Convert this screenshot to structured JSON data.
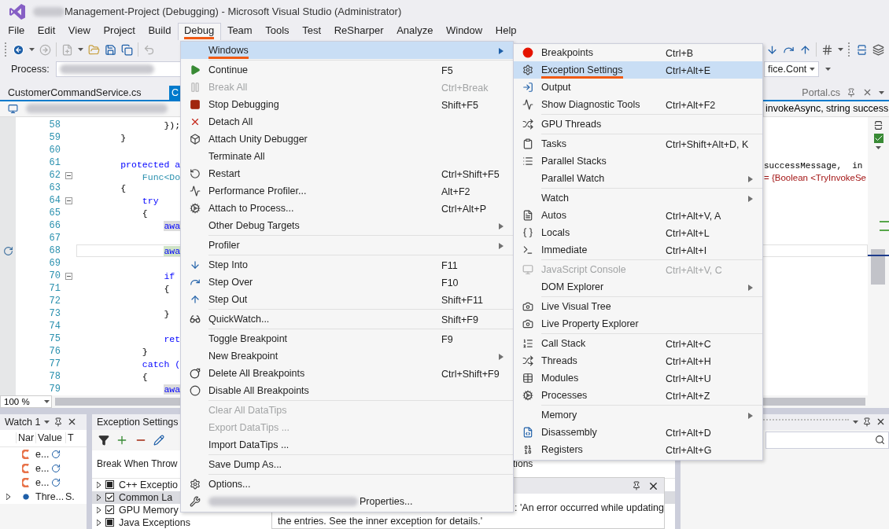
{
  "window": {
    "title": "Management-Project (Debugging) - Microsoft Visual Studio  (Administrator)"
  },
  "menu_bar": [
    {
      "label": "File",
      "selected": false,
      "marked": false
    },
    {
      "label": "Edit",
      "selected": false,
      "marked": false
    },
    {
      "label": "View",
      "selected": false,
      "marked": false
    },
    {
      "label": "Project",
      "selected": false,
      "marked": false
    },
    {
      "label": "Build",
      "selected": false,
      "marked": false
    },
    {
      "label": "Debug",
      "selected": true,
      "marked": true
    },
    {
      "label": "Team",
      "selected": false,
      "marked": false
    },
    {
      "label": "Tools",
      "selected": false,
      "marked": false
    },
    {
      "label": "Test",
      "selected": false,
      "marked": false
    },
    {
      "label": "ReSharper",
      "selected": false,
      "marked": false
    },
    {
      "label": "Analyze",
      "selected": false,
      "marked": false
    },
    {
      "label": "Window",
      "selected": false,
      "marked": false
    },
    {
      "label": "Help",
      "selected": false,
      "marked": false
    }
  ],
  "process_bar": {
    "label": "Process:",
    "target": "fice.Cont"
  },
  "editor_tabs": [
    {
      "label": "CustomerCommandService.cs",
      "selected": false
    },
    {
      "label": "C",
      "selected": true
    }
  ],
  "right_tab": {
    "label": "Portal.cs",
    "selected": false
  },
  "navigation": {
    "member": "invokeAsync, string success"
  },
  "editor": {
    "lines": [
      {
        "number": "58",
        "code": "                });",
        "kind": "plain",
        "foldable": false,
        "current": false,
        "shaded": false
      },
      {
        "number": "59",
        "code": "        }",
        "kind": "plain",
        "foldable": false,
        "current": false,
        "shaded": false
      },
      {
        "number": "60",
        "foldable": false,
        "current": false
      },
      {
        "number": "61",
        "code": "        protected a",
        "kind": "keyword",
        "foldable": false,
        "current": false,
        "shaded": false,
        "right": {
          "text": "successMessage,  in",
          "kind": "code"
        }
      },
      {
        "number": "62",
        "code": "            Func<Do",
        "kind": "type",
        "foldable": true,
        "current": false,
        "shaded": false,
        "right": {
          "text": "= {Boolean <TryInvokeSe",
          "kind": "datatip"
        }
      },
      {
        "number": "63",
        "code": "        {",
        "kind": "plain",
        "foldable": false,
        "current": false,
        "shaded": false
      },
      {
        "number": "64",
        "code": "            try",
        "kind": "keyword",
        "foldable": true,
        "current": false,
        "shaded": false
      },
      {
        "number": "65",
        "code": "            {",
        "kind": "plain",
        "foldable": false,
        "current": false,
        "shaded": false
      },
      {
        "number": "66",
        "code": "                awa",
        "kind": "keyword",
        "foldable": false,
        "current": false,
        "shaded": true
      },
      {
        "number": "67",
        "foldable": false,
        "current": false
      },
      {
        "number": "68",
        "code": "                awa",
        "kind": "keyword",
        "foldable": false,
        "current": true,
        "shaded": true
      },
      {
        "number": "69",
        "foldable": false,
        "current": false
      },
      {
        "number": "70",
        "code": "                if",
        "kind": "keyword",
        "foldable": true,
        "current": false,
        "shaded": false
      },
      {
        "number": "71",
        "code": "                {",
        "kind": "plain",
        "foldable": false,
        "current": false,
        "shaded": false
      },
      {
        "number": "72",
        "foldable": false,
        "current": false
      },
      {
        "number": "73",
        "code": "                }",
        "kind": "plain",
        "foldable": false,
        "current": false,
        "shaded": false
      },
      {
        "number": "74",
        "foldable": false,
        "current": false
      },
      {
        "number": "75",
        "code": "                ret",
        "kind": "keyword",
        "foldable": false,
        "current": false,
        "shaded": false
      },
      {
        "number": "76",
        "code": "            }",
        "kind": "plain",
        "foldable": false,
        "current": false,
        "shaded": false
      },
      {
        "number": "77",
        "code": "            catch (",
        "kind": "keyword",
        "foldable": false,
        "current": false,
        "shaded": false
      },
      {
        "number": "78",
        "code": "            {",
        "kind": "plain",
        "foldable": false,
        "current": false,
        "shaded": false
      },
      {
        "number": "79",
        "code": "                awa",
        "kind": "keyword",
        "foldable": false,
        "current": false,
        "shaded": true
      }
    ]
  },
  "zoom": "100 %",
  "watch": {
    "title": "Watch 1",
    "columns": [
      "Nar",
      "Value",
      "T"
    ],
    "rows": [
      {
        "kind": "exception",
        "value": "e..."
      },
      {
        "kind": "exception",
        "value": "e..."
      },
      {
        "kind": "exception",
        "value": "e..."
      },
      {
        "kind": "thread",
        "value": "Thre...",
        "type": "S."
      }
    ]
  },
  "exception_settings": {
    "title": "Exception Settings",
    "columns": [
      "Break When Throw",
      "tions"
    ],
    "rows": [
      {
        "label": "C++ Exceptio",
        "checked": false,
        "selected": false
      },
      {
        "label": "Common La",
        "checked": true,
        "selected": true
      },
      {
        "label": "GPU Memory",
        "checked": true,
        "selected": false
      },
      {
        "label": "Java Exceptions",
        "checked": false,
        "selected": false
      }
    ]
  },
  "exception_popup": {
    "lines": [
      ": 'An error occurred while updating",
      "the entries. See the inner exception for details.'"
    ]
  },
  "debug_menu": [
    {
      "kind": "item",
      "label": "Windows",
      "disabled": false,
      "submenu": true,
      "selected": true,
      "marked": true
    },
    {
      "kind": "separator"
    },
    {
      "kind": "item",
      "label": "Continue",
      "shortcut": "F5",
      "disabled": false,
      "submenu": false,
      "selected": false,
      "marked": false
    },
    {
      "kind": "item",
      "label": "Break All",
      "shortcut": "Ctrl+Break",
      "disabled": true,
      "submenu": false,
      "selected": false,
      "marked": false
    },
    {
      "kind": "item",
      "label": "Stop Debugging",
      "shortcut": "Shift+F5",
      "disabled": false,
      "submenu": false,
      "selected": false,
      "marked": false
    },
    {
      "kind": "item",
      "label": "Detach All",
      "disabled": false,
      "submenu": false,
      "selected": false,
      "marked": false
    },
    {
      "kind": "item",
      "label": "Attach Unity Debugger",
      "disabled": false,
      "submenu": false,
      "selected": false,
      "marked": false
    },
    {
      "kind": "item",
      "label": "Terminate All",
      "disabled": false,
      "submenu": false,
      "selected": false,
      "marked": false
    },
    {
      "kind": "item",
      "label": "Restart",
      "shortcut": "Ctrl+Shift+F5",
      "disabled": false,
      "submenu": false,
      "selected": false,
      "marked": false
    },
    {
      "kind": "item",
      "label": "Performance Profiler...",
      "shortcut": "Alt+F2",
      "disabled": false,
      "submenu": false,
      "selected": false,
      "marked": false
    },
    {
      "kind": "item",
      "label": "Attach to Process...",
      "shortcut": "Ctrl+Alt+P",
      "disabled": false,
      "submenu": false,
      "selected": false,
      "marked": false
    },
    {
      "kind": "item",
      "label": "Other Debug Targets",
      "disabled": false,
      "submenu": true,
      "selected": false,
      "marked": false
    },
    {
      "kind": "separator"
    },
    {
      "kind": "item",
      "label": "Profiler",
      "disabled": false,
      "submenu": true,
      "selected": false,
      "marked": false
    },
    {
      "kind": "separator"
    },
    {
      "kind": "item",
      "label": "Step Into",
      "shortcut": "F11",
      "disabled": false,
      "submenu": false,
      "selected": false,
      "marked": false
    },
    {
      "kind": "item",
      "label": "Step Over",
      "shortcut": "F10",
      "disabled": false,
      "submenu": false,
      "selected": false,
      "marked": false
    },
    {
      "kind": "item",
      "label": "Step Out",
      "shortcut": "Shift+F11",
      "disabled": false,
      "submenu": false,
      "selected": false,
      "marked": false
    },
    {
      "kind": "separator"
    },
    {
      "kind": "item",
      "label": "QuickWatch...",
      "shortcut": "Shift+F9",
      "disabled": false,
      "submenu": false,
      "selected": false,
      "marked": false
    },
    {
      "kind": "separator"
    },
    {
      "kind": "item",
      "label": "Toggle Breakpoint",
      "shortcut": "F9",
      "disabled": false,
      "submenu": false,
      "selected": false,
      "marked": false
    },
    {
      "kind": "item",
      "label": "New Breakpoint",
      "disabled": false,
      "submenu": true,
      "selected": false,
      "marked": false
    },
    {
      "kind": "item",
      "label": "Delete All Breakpoints",
      "shortcut": "Ctrl+Shift+F9",
      "disabled": false,
      "submenu": false,
      "selected": false,
      "marked": false
    },
    {
      "kind": "item",
      "label": "Disable All Breakpoints",
      "disabled": false,
      "submenu": false,
      "selected": false,
      "marked": false
    },
    {
      "kind": "separator"
    },
    {
      "kind": "item",
      "label": "Clear All DataTips",
      "disabled": true,
      "submenu": false,
      "selected": false,
      "marked": false
    },
    {
      "kind": "item",
      "label": "Export DataTips ...",
      "disabled": true,
      "submenu": false,
      "selected": false,
      "marked": false
    },
    {
      "kind": "item",
      "label": "Import DataTips ...",
      "disabled": false,
      "submenu": false,
      "selected": false,
      "marked": false
    },
    {
      "kind": "separator"
    },
    {
      "kind": "item",
      "label": "Save Dump As...",
      "disabled": false,
      "submenu": false,
      "selected": false,
      "marked": false
    },
    {
      "kind": "separator"
    },
    {
      "kind": "item",
      "label": "Options...",
      "disabled": false,
      "submenu": false,
      "selected": false,
      "marked": false
    },
    {
      "kind": "item",
      "label": "Properties...",
      "disabled": false,
      "submenu": false,
      "selected": false,
      "marked": false,
      "blurred_prefix": true
    }
  ],
  "windows_menu": [
    {
      "kind": "item",
      "label": "Breakpoints",
      "shortcut": "Ctrl+B",
      "disabled": false,
      "submenu": false,
      "selected": false,
      "marked": false
    },
    {
      "kind": "item",
      "label": "Exception Settings",
      "shortcut": "Ctrl+Alt+E",
      "disabled": false,
      "submenu": false,
      "selected": true,
      "marked": true
    },
    {
      "kind": "item",
      "label": "Output",
      "disabled": false,
      "submenu": false,
      "selected": false,
      "marked": false
    },
    {
      "kind": "item",
      "label": "Show Diagnostic Tools",
      "shortcut": "Ctrl+Alt+F2",
      "disabled": false,
      "submenu": false,
      "selected": false,
      "marked": false
    },
    {
      "kind": "separator"
    },
    {
      "kind": "item",
      "label": "GPU Threads",
      "disabled": false,
      "submenu": false,
      "selected": false,
      "marked": false
    },
    {
      "kind": "separator"
    },
    {
      "kind": "item",
      "label": "Tasks",
      "shortcut": "Ctrl+Shift+Alt+D, K",
      "disabled": false,
      "submenu": false,
      "selected": false,
      "marked": false
    },
    {
      "kind": "item",
      "label": "Parallel Stacks",
      "disabled": false,
      "submenu": false,
      "selected": false,
      "marked": false
    },
    {
      "kind": "item",
      "label": "Parallel Watch",
      "disabled": false,
      "submenu": true,
      "selected": false,
      "marked": false
    },
    {
      "kind": "separator"
    },
    {
      "kind": "item",
      "label": "Watch",
      "disabled": false,
      "submenu": true,
      "selected": false,
      "marked": false
    },
    {
      "kind": "item",
      "label": "Autos",
      "shortcut": "Ctrl+Alt+V, A",
      "disabled": false,
      "submenu": false,
      "selected": false,
      "marked": false
    },
    {
      "kind": "item",
      "label": "Locals",
      "shortcut": "Ctrl+Alt+L",
      "disabled": false,
      "submenu": false,
      "selected": false,
      "marked": false
    },
    {
      "kind": "item",
      "label": "Immediate",
      "shortcut": "Ctrl+Alt+I",
      "disabled": false,
      "submenu": false,
      "selected": false,
      "marked": false
    },
    {
      "kind": "separator"
    },
    {
      "kind": "item",
      "label": "JavaScript Console",
      "shortcut": "Ctrl+Alt+V, C",
      "disabled": true,
      "submenu": false,
      "selected": false,
      "marked": false
    },
    {
      "kind": "item",
      "label": "DOM Explorer",
      "disabled": false,
      "submenu": true,
      "selected": false,
      "marked": false
    },
    {
      "kind": "separator"
    },
    {
      "kind": "item",
      "label": "Live Visual Tree",
      "disabled": false,
      "submenu": false,
      "selected": false,
      "marked": false
    },
    {
      "kind": "item",
      "label": "Live Property Explorer",
      "disabled": false,
      "submenu": false,
      "selected": false,
      "marked": false
    },
    {
      "kind": "separator"
    },
    {
      "kind": "item",
      "label": "Call Stack",
      "shortcut": "Ctrl+Alt+C",
      "disabled": false,
      "submenu": false,
      "selected": false,
      "marked": false
    },
    {
      "kind": "item",
      "label": "Threads",
      "shortcut": "Ctrl+Alt+H",
      "disabled": false,
      "submenu": false,
      "selected": false,
      "marked": false
    },
    {
      "kind": "item",
      "label": "Modules",
      "shortcut": "Ctrl+Alt+U",
      "disabled": false,
      "submenu": false,
      "selected": false,
      "marked": false
    },
    {
      "kind": "item",
      "label": "Processes",
      "shortcut": "Ctrl+Alt+Z",
      "disabled": false,
      "submenu": false,
      "selected": false,
      "marked": false
    },
    {
      "kind": "separator"
    },
    {
      "kind": "item",
      "label": "Memory",
      "disabled": false,
      "submenu": true,
      "selected": false,
      "marked": false
    },
    {
      "kind": "item",
      "label": "Disassembly",
      "shortcut": "Ctrl+Alt+D",
      "disabled": false,
      "submenu": false,
      "selected": false,
      "marked": false
    },
    {
      "kind": "item",
      "label": "Registers",
      "shortcut": "Ctrl+Alt+G",
      "disabled": false,
      "submenu": false,
      "selected": false,
      "marked": false
    }
  ]
}
